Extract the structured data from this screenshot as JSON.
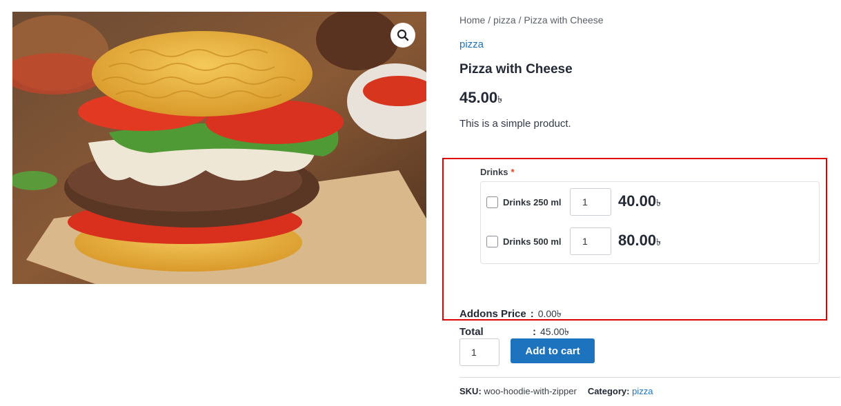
{
  "breadcrumb": {
    "home": "Home",
    "sep1": " / ",
    "category": "pizza",
    "sep2": " / ",
    "current": "Pizza with Cheese"
  },
  "product": {
    "category_link": "pizza",
    "title": "Pizza with Cheese",
    "price": "45.00",
    "currency_symbol": "৳",
    "short_description": "This is a simple product."
  },
  "gallery": {
    "zoom_icon": "search-icon"
  },
  "addons": {
    "group_label": "Drinks",
    "required_mark": "*",
    "options": [
      {
        "label": "Drinks 250 ml",
        "qty": "1",
        "price": "40.00",
        "checked": false
      },
      {
        "label": "Drinks 500 ml",
        "qty": "1",
        "price": "80.00",
        "checked": false
      }
    ],
    "addons_price_label": "Addons Price",
    "addons_price_value": "0.00৳",
    "total_label": "Total",
    "total_value": "45.00৳",
    "colon": ":"
  },
  "cart": {
    "qty": "1",
    "button_label": "Add to cart"
  },
  "meta": {
    "sku_label": "SKU:",
    "sku_value": "woo-hoodie-with-zipper",
    "category_label": "Category:",
    "category_value": "pizza"
  },
  "colors": {
    "accent": "#1e73be",
    "highlight_border": "#e10000",
    "required": "#e2401c"
  }
}
